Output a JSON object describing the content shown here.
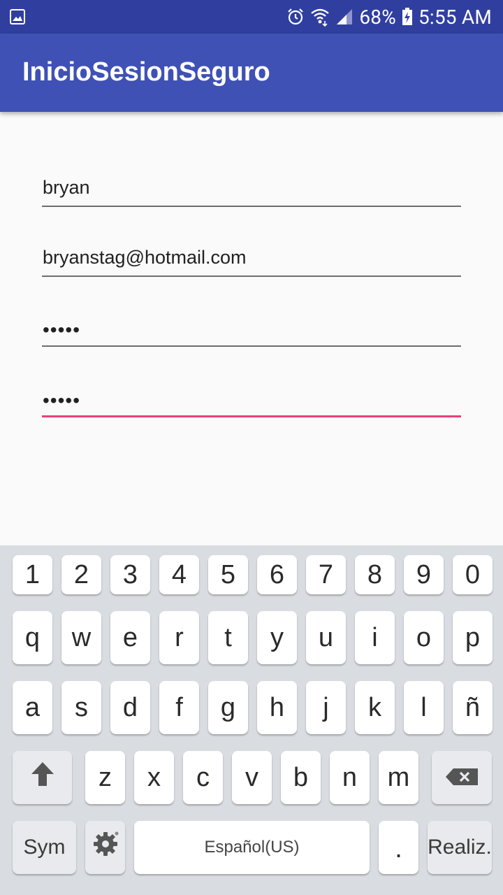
{
  "status_bar": {
    "battery_percent": "68%",
    "time": "5:55 AM",
    "icons": [
      "gallery-icon",
      "alarm-icon",
      "wifi-icon",
      "signal-icon",
      "battery-charging-icon"
    ]
  },
  "app_bar": {
    "title": "InicioSesionSeguro"
  },
  "form": {
    "username_value": "bryan",
    "email_value": "bryanstag@hotmail.com",
    "password_masked": "•••••",
    "confirm_password_masked": "•••••"
  },
  "keyboard": {
    "number_row": [
      "1",
      "2",
      "3",
      "4",
      "5",
      "6",
      "7",
      "8",
      "9",
      "0"
    ],
    "row1": [
      "q",
      "w",
      "e",
      "r",
      "t",
      "y",
      "u",
      "i",
      "o",
      "p"
    ],
    "row2": [
      "a",
      "s",
      "d",
      "f",
      "g",
      "h",
      "j",
      "k",
      "l",
      "ñ"
    ],
    "row3": [
      "z",
      "x",
      "c",
      "v",
      "b",
      "n",
      "m"
    ],
    "sym_label": "Sym",
    "space_label": "Español(US)",
    "period_label": ".",
    "action_label": "Realiz."
  },
  "colors": {
    "status_bar": "#303f9f",
    "app_bar": "#3f51b5",
    "focus_accent": "#e8417c",
    "keyboard_bg": "#d9dce0"
  }
}
